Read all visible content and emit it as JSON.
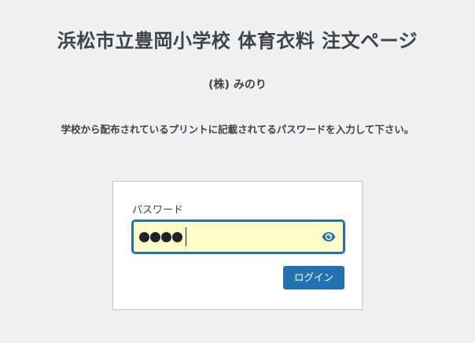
{
  "header": {
    "title": "浜松市立豊岡小学校 体育衣料 注文ページ",
    "company": "(株) みのり",
    "instruction": "学校から配布されているプリントに記載されてるパスワードを入力して下さい。"
  },
  "login": {
    "password_label": "パスワード",
    "password_length": 4,
    "button_label": "ログイン",
    "toggle_icon": "eye-icon"
  },
  "colors": {
    "accent": "#2271b1",
    "field_background": "#fefcc7",
    "page_background": "#f0f0f1",
    "text": "#3c434a"
  }
}
